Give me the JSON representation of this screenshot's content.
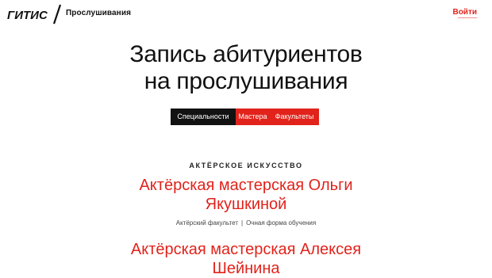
{
  "header": {
    "logo_text": "ГИТИС",
    "section_name": "Прослушивания",
    "login_label": "Войти"
  },
  "title": {
    "line1": "Запись абитуриентов",
    "line2": "на прослушивания"
  },
  "tabs": [
    {
      "label": "Специальности",
      "active": true
    },
    {
      "label": "Мастера",
      "active": false
    },
    {
      "label": "Факультеты",
      "active": false
    }
  ],
  "category": "Актёрское искусство",
  "courses": [
    {
      "title_line1": "Актёрская мастерская Ольги",
      "title_line2": "Якушкиной",
      "faculty": "Актёрский факультет",
      "separator": "|",
      "form": "Очная форма обучения"
    },
    {
      "title_line1": "Актёрская мастерская Алексея",
      "title_line2": "Шейнина"
    }
  ],
  "colors": {
    "accent": "#e1231b",
    "dark": "#121212",
    "background": "#ffffff"
  }
}
